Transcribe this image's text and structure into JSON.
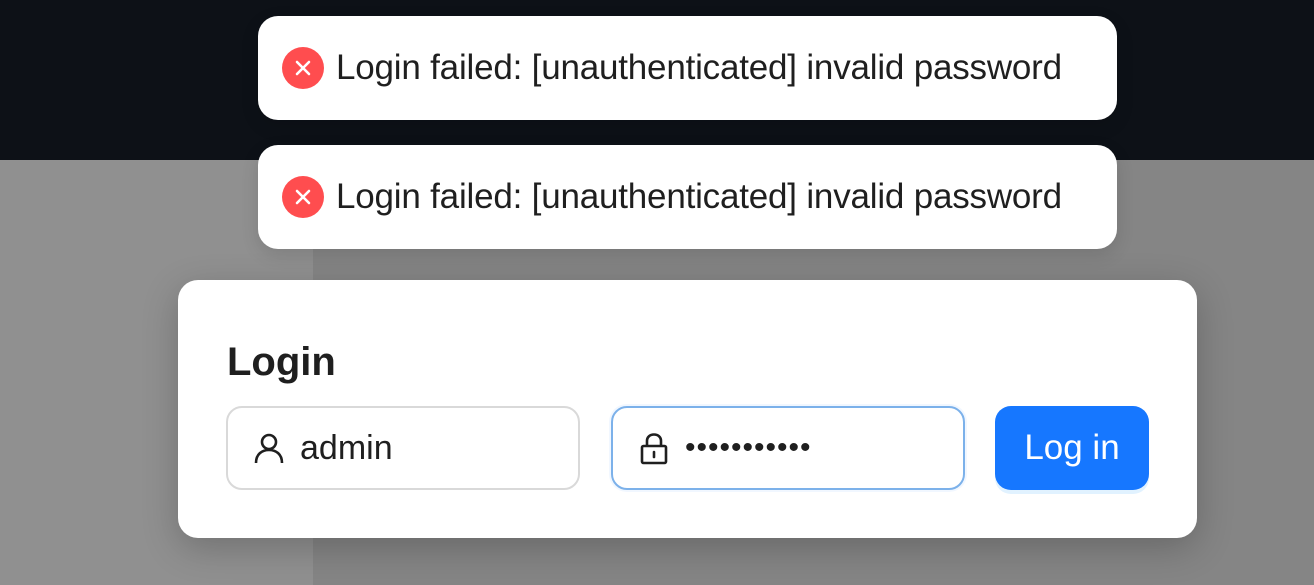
{
  "notifications": [
    {
      "type": "error",
      "icon": "close-circle-icon",
      "message": "Login failed: [unauthenticated] invalid password"
    },
    {
      "type": "error",
      "icon": "close-circle-icon",
      "message": "Login failed: [unauthenticated] invalid password"
    }
  ],
  "login_form": {
    "title": "Login",
    "username": {
      "icon": "user-icon",
      "value": "admin"
    },
    "password": {
      "icon": "lock-icon",
      "value": "•••••••••••"
    },
    "submit_label": "Log in"
  },
  "colors": {
    "accent": "#1677ff",
    "error": "#ff4d4f",
    "topbar": "#0d1117",
    "overlay": "#8d8d8d"
  }
}
